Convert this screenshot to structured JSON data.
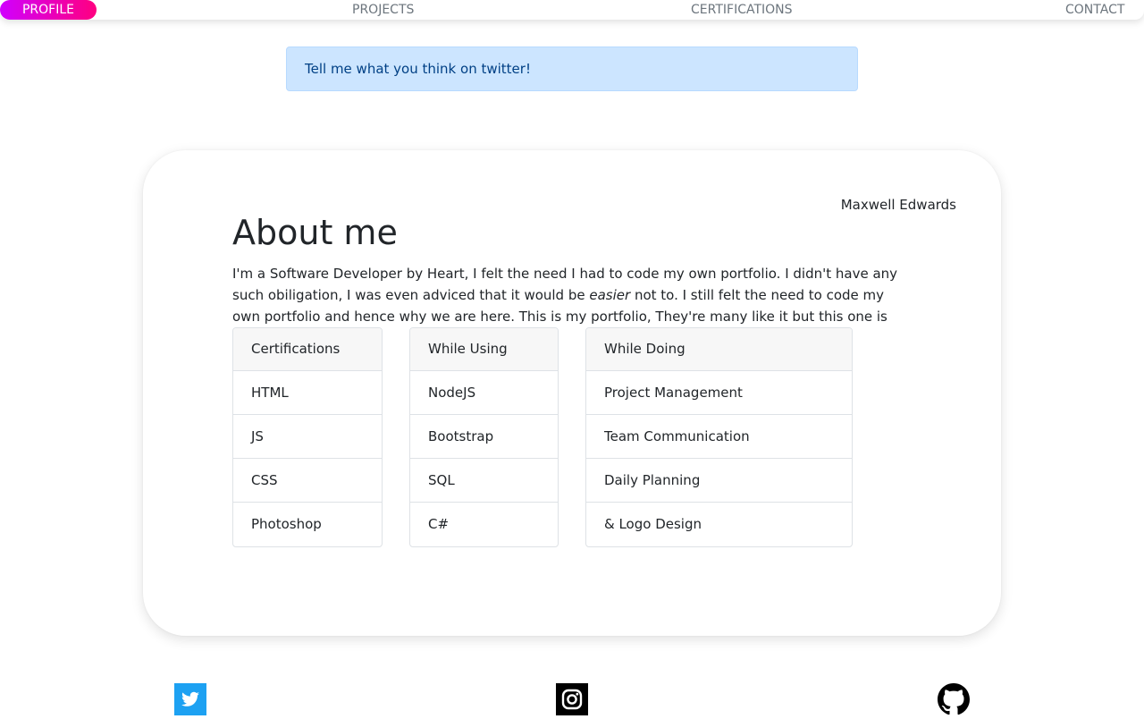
{
  "nav": {
    "items": [
      {
        "label": "PROFILE",
        "active": true
      },
      {
        "label": "PROJECTS",
        "active": false
      },
      {
        "label": "CERTIFICATIONS",
        "active": false
      },
      {
        "label": "CONTACT",
        "active": false
      }
    ],
    "active_gradient_start": "#d000ff",
    "active_gradient_end": "#ff0080"
  },
  "alert": {
    "text": "Tell me what you think on twitter!"
  },
  "profile": {
    "author": "Maxwell Edwards",
    "title": "About me",
    "bio_part1": "I'm a Software Developer by Heart, I felt the need I had to code my own portfolio. I didn't have any such obiligation, I was even adviced that it would be ",
    "bio_emphasis": "easier",
    "bio_part2": " not to. I still felt the need to code my own portfolio and hence why we are here. This is my portfolio, They're many like it but this one is mine."
  },
  "lists": {
    "certifications": {
      "header": "Certifications",
      "items": [
        "HTML",
        "JS",
        "CSS",
        "Photoshop"
      ]
    },
    "while_using": {
      "header": "While Using",
      "items": [
        "NodeJS",
        "Bootstrap",
        "SQL",
        "C#"
      ]
    },
    "while_doing": {
      "header": "While Doing",
      "items": [
        "Project Management",
        "Team Communication",
        "Daily Planning",
        "& Logo Design"
      ]
    }
  },
  "footer": {
    "icons": [
      "twitter-icon",
      "instagram-icon",
      "github-icon"
    ],
    "twitter_color": "#1da1f2"
  }
}
